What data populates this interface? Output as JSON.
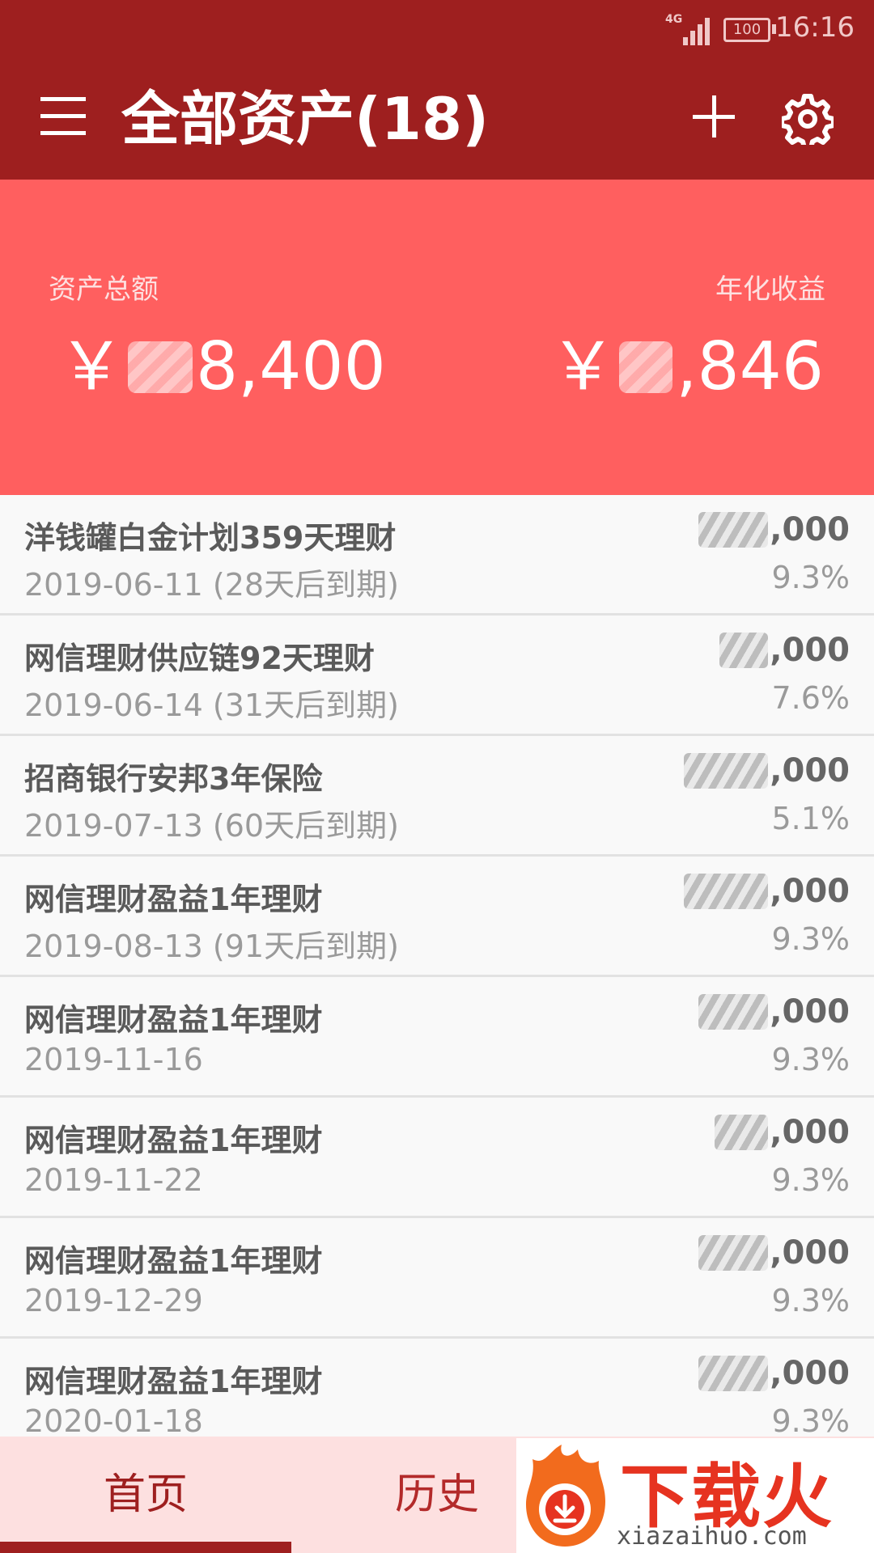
{
  "status_bar": {
    "network": "4G",
    "battery": "100",
    "time": "16:16"
  },
  "header": {
    "title": "全部资产(18)",
    "icons": [
      "menu-icon",
      "add-icon",
      "gear-icon"
    ]
  },
  "summary": {
    "total_label": "资产总额",
    "total_currency": "￥",
    "total_value_visible": "8,400",
    "yield_label": "年化收益",
    "yield_currency": "￥",
    "yield_value_visible": ",846"
  },
  "assets": [
    {
      "name": "洋钱罐白金计划359天理财",
      "date": "2019-06-11 (28天后到期)",
      "amount_visible": ",000",
      "rate": "9.3%"
    },
    {
      "name": "网信理财供应链92天理财",
      "date": "2019-06-14 (31天后到期)",
      "amount_visible": ",000",
      "rate": "7.6%"
    },
    {
      "name": "招商银行安邦3年保险",
      "date": "2019-07-13 (60天后到期)",
      "amount_visible": ",000",
      "rate": "5.1%"
    },
    {
      "name": "网信理财盈益1年理财",
      "date": "2019-08-13 (91天后到期)",
      "amount_visible": ",000",
      "rate": "9.3%"
    },
    {
      "name": "网信理财盈益1年理财",
      "date": "2019-11-16",
      "amount_visible": ",000",
      "rate": "9.3%"
    },
    {
      "name": "网信理财盈益1年理财",
      "date": "2019-11-22",
      "amount_visible": ",000",
      "rate": "9.3%"
    },
    {
      "name": "网信理财盈益1年理财",
      "date": "2019-12-29",
      "amount_visible": ",000",
      "rate": "9.3%"
    },
    {
      "name": "网信理财盈益1年理财",
      "date": "2020-01-18",
      "amount_visible": ",000",
      "rate": "9.3%"
    }
  ],
  "bottom_nav": {
    "home_label": "首页",
    "history_label": "历史",
    "active": "home"
  },
  "watermark": {
    "brand": "下载火",
    "url": "xiazaihuo.com"
  },
  "colors": {
    "primary_dark": "#9e1f1f",
    "summary_bg": "#ff5f5f",
    "nav_bg": "#fde0e0"
  }
}
